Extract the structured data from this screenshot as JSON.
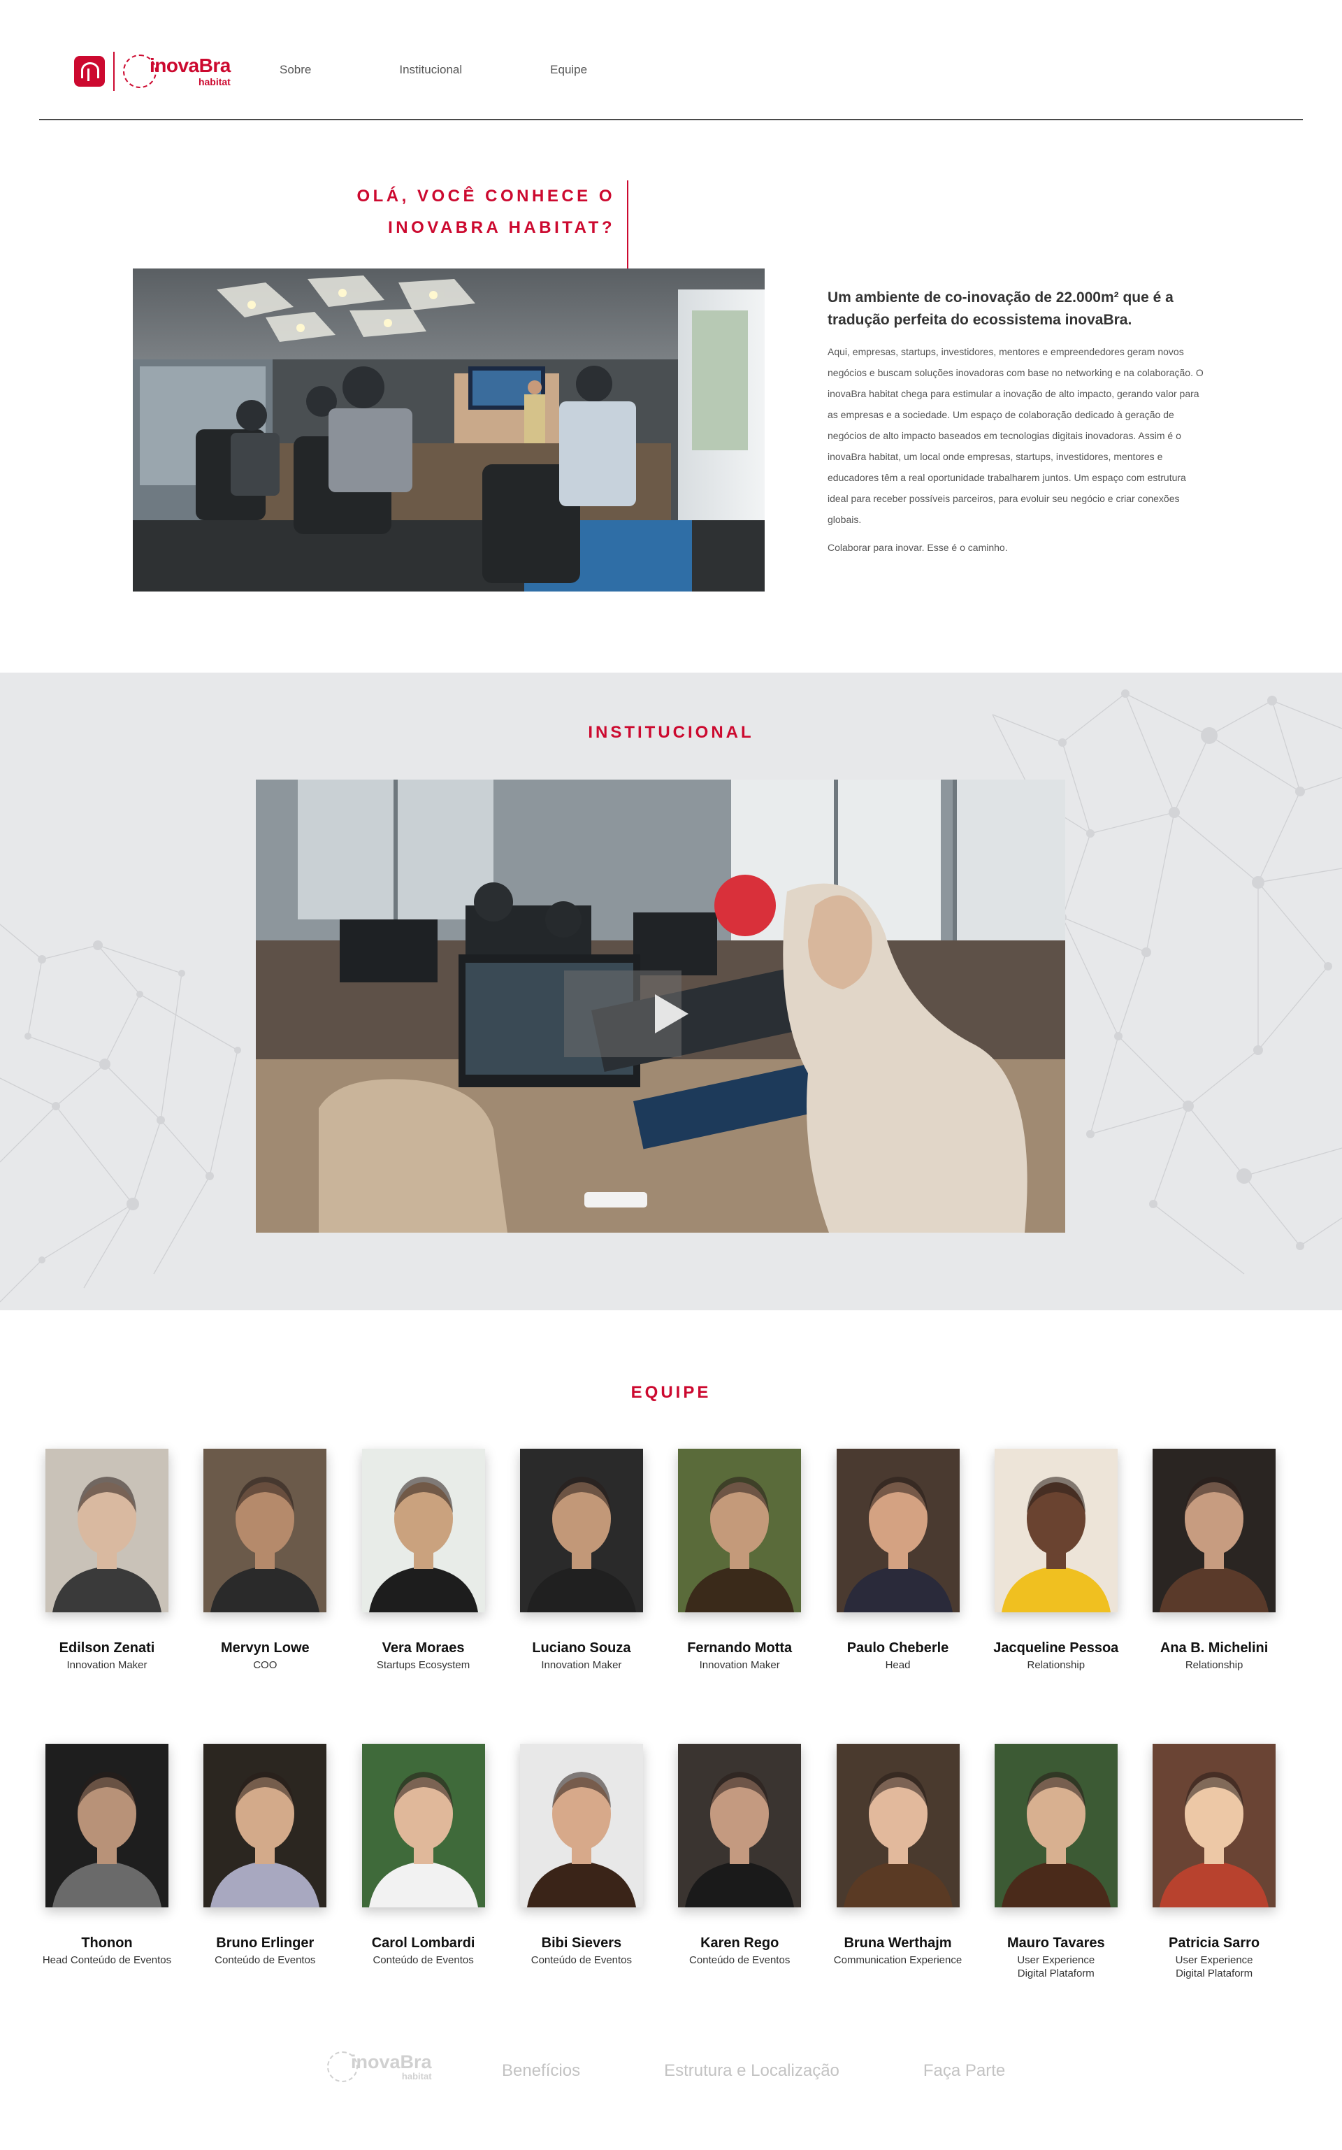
{
  "header": {
    "logo_text": "inovaBra",
    "logo_sub": "habitat",
    "nav": [
      "Sobre",
      "Institucional",
      "Equipe"
    ]
  },
  "intro": {
    "title_line1": "OLÁ, VOCÊ CONHECE O",
    "title_line2": "INOVABRA HABITAT?",
    "heading": "Um ambiente de co-inovação de 22.000m² que é a tradução perfeita do ecossistema inovaBra.",
    "body": "Aqui, empresas, startups, investidores, mentores e empreendedores geram novos negócios e buscam soluções inovadoras com base no networking e na colaboração. O inovaBra habitat chega para estimular a inovação de alto impacto, gerando valor para as empresas e a sociedade. Um espaço de colaboração dedicado à geração de negócios de alto impacto baseados em tecnologias digitais inovadoras. Assim é o inovaBra habitat, um local onde empresas, startups, investidores, mentores e educadores têm a real oportunidade trabalharem juntos. Um espaço com estrutura ideal para receber possíveis parceiros, para evoluir seu negócio e criar conexões globais.",
    "closing": "Colaborar para inovar. Esse é o caminho."
  },
  "institucional": {
    "title": "INSTITUCIONAL"
  },
  "equipe": {
    "title": "EQUIPE",
    "members": [
      {
        "name": "Edilson Zenati",
        "role": "Innovation Maker"
      },
      {
        "name": "Mervyn Lowe",
        "role": "COO"
      },
      {
        "name": "Vera Moraes",
        "role": "Startups Ecosystem"
      },
      {
        "name": "Luciano Souza",
        "role": "Innovation Maker"
      },
      {
        "name": "Fernando Motta",
        "role": "Innovation Maker"
      },
      {
        "name": "Paulo Cheberle",
        "role": "Head"
      },
      {
        "name": "Jacqueline Pessoa",
        "role": "Relationship"
      },
      {
        "name": "Ana B. Michelini",
        "role": "Relationship"
      },
      {
        "name": "Thonon",
        "role": "Head Conteúdo de Eventos"
      },
      {
        "name": "Bruno Erlinger",
        "role": "Conteúdo de Eventos"
      },
      {
        "name": "Carol Lombardi",
        "role": "Conteúdo de Eventos"
      },
      {
        "name": "Bibi Sievers",
        "role": "Conteúdo de Eventos"
      },
      {
        "name": "Karen Rego",
        "role": "Conteúdo de Eventos"
      },
      {
        "name": "Bruna Werthajm",
        "role": "Communication Experience"
      },
      {
        "name": "Mauro Tavares",
        "role": "User Experience\nDigital Plataform"
      },
      {
        "name": "Patricia Sarro",
        "role": "User Experience\nDigital Plataform"
      }
    ]
  },
  "footer": {
    "logo_text": "inovaBra",
    "logo_sub": "habitat",
    "links": [
      "Benefícios",
      "Estrutura e Localização",
      "Faça Parte"
    ]
  },
  "colors": {
    "accent": "#cc092f",
    "section_bg": "#e7e8ea"
  },
  "icons": {
    "play": "play-icon",
    "brand": "bradesco-logo-icon"
  }
}
